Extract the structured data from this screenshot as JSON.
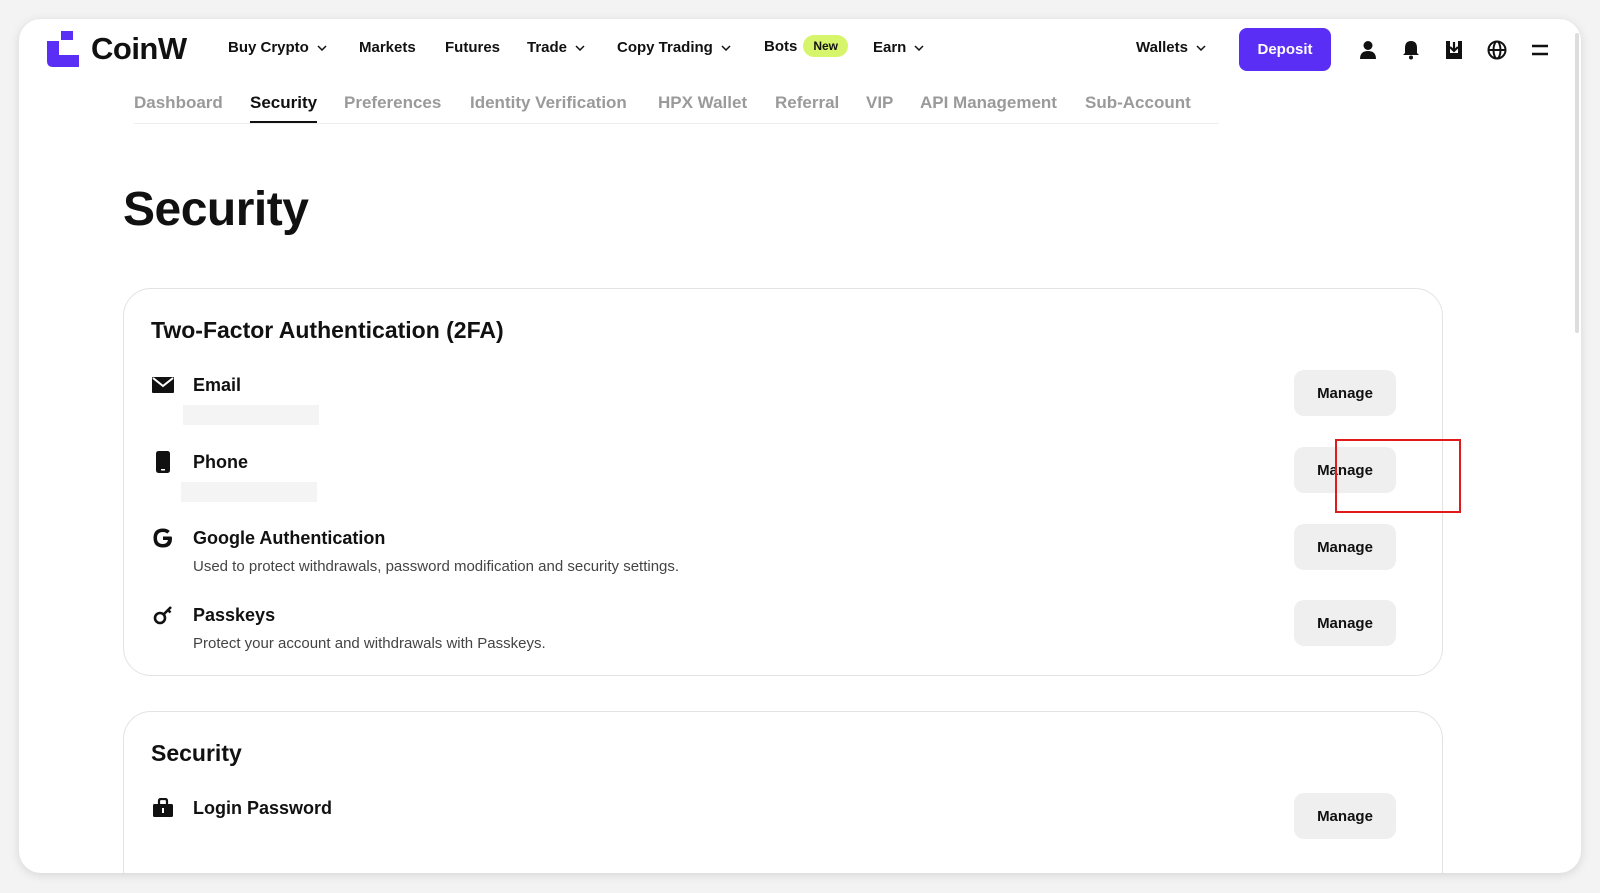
{
  "brand": {
    "name": "CoinW",
    "accent": "#5b2ef5",
    "new_badge_color": "#d6f56b"
  },
  "topnav": {
    "items": [
      {
        "label": "Buy Crypto",
        "dropdown": true
      },
      {
        "label": "Markets",
        "dropdown": false
      },
      {
        "label": "Futures",
        "dropdown": false
      },
      {
        "label": "Trade",
        "dropdown": true
      },
      {
        "label": "Copy Trading",
        "dropdown": true
      },
      {
        "label": "Bots",
        "dropdown": false,
        "badge": "New"
      },
      {
        "label": "Earn",
        "dropdown": true
      }
    ],
    "wallets_label": "Wallets",
    "deposit_label": "Deposit",
    "icons": [
      "user-icon",
      "bell-icon",
      "download-icon",
      "globe-icon",
      "menu-icon"
    ]
  },
  "subtabs": {
    "items": [
      "Dashboard",
      "Security",
      "Preferences",
      "Identity Verification",
      "HPX Wallet",
      "Referral",
      "VIP",
      "API Management",
      "Sub-Account"
    ],
    "active": "Security"
  },
  "page_title": "Security",
  "two_fa": {
    "title": "Two-Factor Authentication (2FA)",
    "rows": [
      {
        "icon": "mail-icon",
        "label": "Email",
        "description": "",
        "button": "Manage"
      },
      {
        "icon": "phone-icon",
        "label": "Phone",
        "description": "",
        "button": "Manage"
      },
      {
        "icon": "google-icon",
        "label": "Google Authentication",
        "description": "Used to protect withdrawals, password modification and security settings.",
        "button": "Manage"
      },
      {
        "icon": "key-icon",
        "label": "Passkeys",
        "description": "Protect your account and withdrawals with Passkeys.",
        "button": "Manage"
      }
    ]
  },
  "security": {
    "title": "Security",
    "rows": [
      {
        "icon": "lock-icon",
        "label": "Login Password",
        "button": "Manage"
      }
    ]
  },
  "annotation": {
    "highlight_color": "#e01b1b",
    "target": "phone-manage-button"
  }
}
